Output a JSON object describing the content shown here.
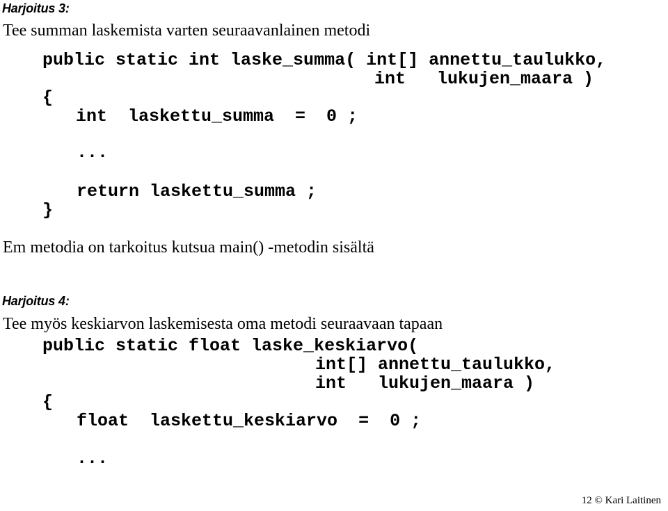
{
  "page": {
    "background_color": "#ffffff",
    "text_color": "#000000"
  },
  "exercise_3": {
    "heading": "Harjoitus 3:",
    "instruction": "Tee summan laskemista varten seuraavanlainen metodi",
    "code_lines": [
      "public static int laske_summa( int[] annettu_taulukko,",
      "int   lukujen_maara )",
      "{",
      "int  laskettu_summa  =  0 ;",
      "...",
      "return laskettu_summa ;",
      "}"
    ],
    "note": "Em metodia on tarkoitus kutsua main() -metodin sisältä"
  },
  "exercise_4": {
    "heading": "Harjoitus 4:",
    "instruction": "Tee myös keskiarvon laskemisesta oma metodi seuraavaan tapaan",
    "code_lines": [
      "public static float laske_keskiarvo(",
      "int[] annettu_taulukko,",
      "int   lukujen_maara )",
      "{",
      "float  laskettu_keskiarvo  =  0 ;",
      "..."
    ]
  },
  "footer": {
    "text": "12 © Kari Laitinen"
  }
}
